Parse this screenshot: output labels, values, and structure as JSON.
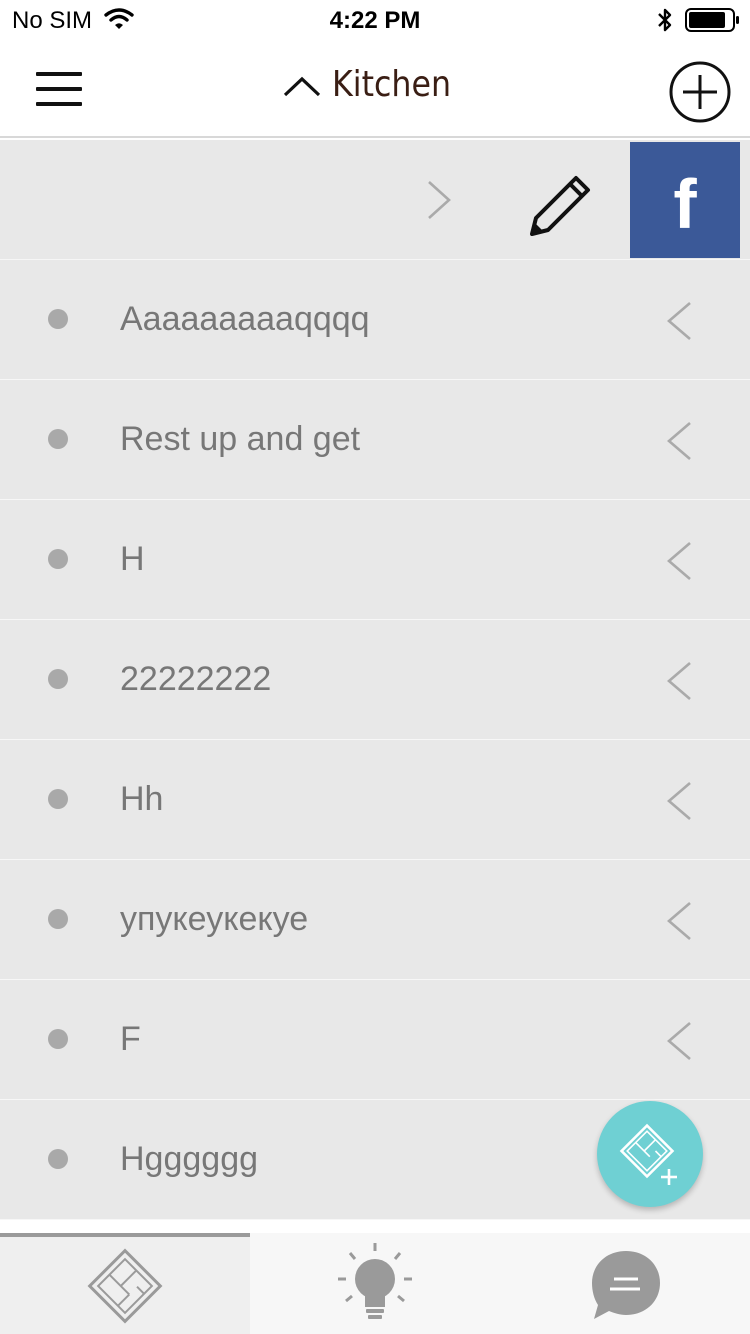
{
  "status_bar": {
    "carrier": "No SIM",
    "time": "4:22 PM"
  },
  "nav": {
    "title": "Kitchen",
    "menu_icon": "hamburger-icon",
    "caret_icon": "chevron-up-icon",
    "add_icon": "plus-circle-icon"
  },
  "actions": {
    "arrow_icon": "chevron-right-icon",
    "edit_icon": "pencil-icon",
    "facebook_label": "f"
  },
  "list": {
    "items": [
      {
        "label": "Aaaaaaaaaqqqq"
      },
      {
        "label": "Rest up and get"
      },
      {
        "label": "H"
      },
      {
        "label": "22222222"
      },
      {
        "label": "Hh"
      },
      {
        "label": "упукеукекуе"
      },
      {
        "label": "F"
      },
      {
        "label": "Hgggggg"
      }
    ]
  },
  "fab": {
    "icon": "add-floorplan-icon"
  },
  "tabs": [
    {
      "icon": "floorplan-icon",
      "active": true
    },
    {
      "icon": "lightbulb-icon",
      "active": false
    },
    {
      "icon": "chat-icon",
      "active": false
    }
  ],
  "colors": {
    "facebook": "#3b5998",
    "fab": "#6fd0d3",
    "list_bg": "#e8e8e8",
    "title": "#3a1e14"
  }
}
